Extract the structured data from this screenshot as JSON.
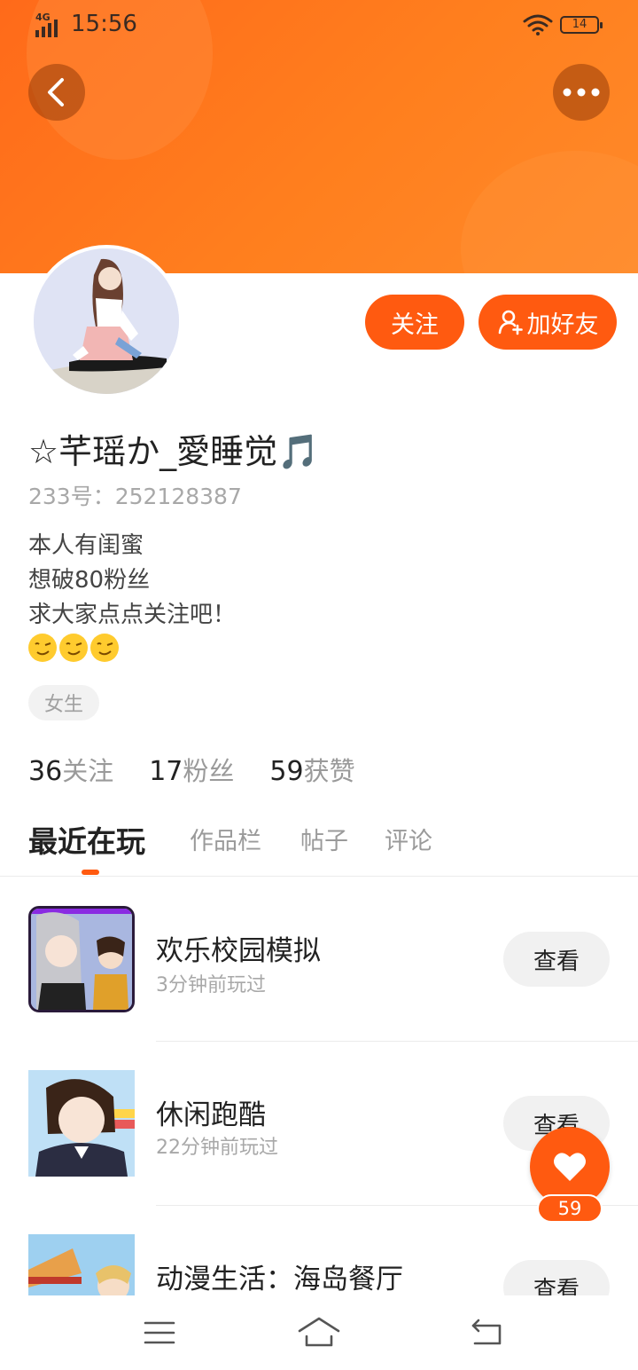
{
  "status_bar": {
    "network": "4G",
    "time": "15:56",
    "battery": "14"
  },
  "header": {
    "back_icon": "chevron-left-icon",
    "more_icon": "more-horizontal-icon",
    "accent_color": "#ff5a10"
  },
  "profile": {
    "follow_label": "关注",
    "add_friend_label": "加好友",
    "username": "☆芊瑶か_愛睡觉🎵",
    "user_id": "233号：252128387",
    "bio_lines": [
      "本人有闺蜜",
      "想破80粉丝",
      "求大家点点关注吧！"
    ],
    "emojis": [
      "wink-emoji",
      "wink-emoji",
      "wink-emoji"
    ],
    "gender_tag": "女生"
  },
  "stats": [
    {
      "count": "36",
      "label": "关注"
    },
    {
      "count": "17",
      "label": "粉丝"
    },
    {
      "count": "59",
      "label": "获赞"
    }
  ],
  "tabs": [
    {
      "label": "最近在玩",
      "active": true
    },
    {
      "label": "作品栏",
      "active": false
    },
    {
      "label": "帖子",
      "active": false
    },
    {
      "label": "评论",
      "active": false
    }
  ],
  "recent_games": [
    {
      "title": "欢乐校园模拟",
      "played": "3分钟前玩过",
      "action": "查看"
    },
    {
      "title": "休闲跑酷",
      "played": "22分钟前玩过",
      "action": "查看"
    },
    {
      "title": "动漫生活：海岛餐厅",
      "played": "",
      "action": "查看"
    }
  ],
  "like_fab": {
    "icon": "heart-icon",
    "count": "59"
  },
  "nav_bar": {
    "menu_icon": "menu-icon",
    "home_icon": "home-icon",
    "back_icon": "back-icon"
  }
}
